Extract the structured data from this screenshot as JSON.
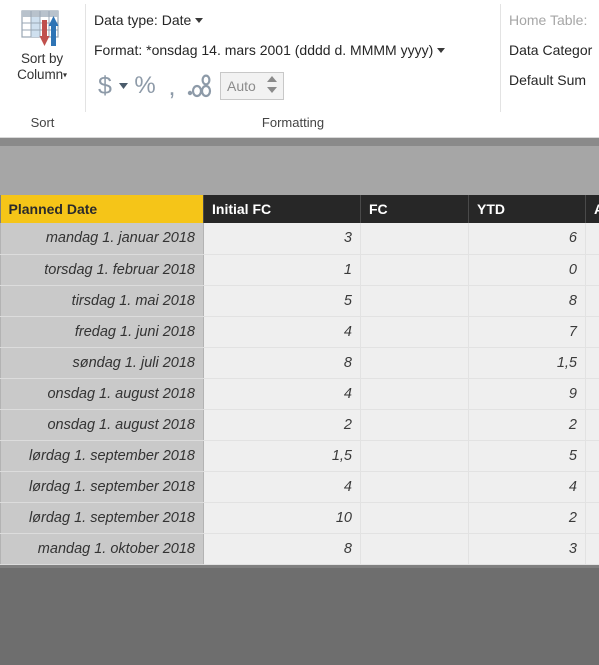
{
  "ribbon": {
    "sort_group": {
      "button_label_line1": "Sort by",
      "button_label_line2": "Column",
      "dropdown_caret": "▾",
      "icon": "sort-by-column-icon",
      "group_title": "Sort"
    },
    "formatting_group": {
      "data_type_label": "Data type: Date",
      "format_label": "Format: *onsdag 14. mars 2001 (dddd d. MMMM yyyy)",
      "currency_symbol": "$",
      "percent_symbol": "%",
      "comma_symbol": ",",
      "decimal_symbol": ".00",
      "decimal_places_value": "Auto",
      "group_title": "Formatting"
    },
    "properties_group": {
      "home_table_label": "Home Table:",
      "data_category_label": "Data Categor",
      "default_summarization_label": "Default Sum"
    }
  },
  "grid": {
    "sorted_column_index": 0,
    "columns": [
      {
        "header": "Planned Date",
        "align": "right",
        "sorted": true
      },
      {
        "header": "Initial FC",
        "align": "right",
        "sorted": false
      },
      {
        "header": "FC",
        "align": "right",
        "sorted": false
      },
      {
        "header": "YTD",
        "align": "right",
        "sorted": false
      },
      {
        "header": "A",
        "align": "right",
        "sorted": false
      }
    ],
    "rows": [
      {
        "planned_date": "mandag 1. januar 2018",
        "initial_fc": "3",
        "fc": "",
        "ytd": "6",
        "a": ""
      },
      {
        "planned_date": "torsdag 1. februar 2018",
        "initial_fc": "1",
        "fc": "",
        "ytd": "0",
        "a": ""
      },
      {
        "planned_date": "tirsdag 1. mai 2018",
        "initial_fc": "5",
        "fc": "",
        "ytd": "8",
        "a": ""
      },
      {
        "planned_date": "fredag 1. juni 2018",
        "initial_fc": "4",
        "fc": "",
        "ytd": "7",
        "a": ""
      },
      {
        "planned_date": "søndag 1. juli 2018",
        "initial_fc": "8",
        "fc": "",
        "ytd": "1,5",
        "a": ""
      },
      {
        "planned_date": "onsdag 1. august 2018",
        "initial_fc": "4",
        "fc": "",
        "ytd": "9",
        "a": ""
      },
      {
        "planned_date": "onsdag 1. august 2018",
        "initial_fc": "2",
        "fc": "",
        "ytd": "2",
        "a": ""
      },
      {
        "planned_date": "lørdag 1. september 2018",
        "initial_fc": "1,5",
        "fc": "",
        "ytd": "5",
        "a": ""
      },
      {
        "planned_date": "lørdag 1. september 2018",
        "initial_fc": "4",
        "fc": "",
        "ytd": "4",
        "a": ""
      },
      {
        "planned_date": "lørdag 1. september 2018",
        "initial_fc": "10",
        "fc": "",
        "ytd": "2",
        "a": ""
      },
      {
        "planned_date": "mandag 1. oktober 2018",
        "initial_fc": "8",
        "fc": "",
        "ytd": "3",
        "a": ""
      }
    ]
  },
  "colors": {
    "sorted_header_bg": "#f5c518",
    "header_bg": "#272727",
    "date_column_bg": "#c9c9c9",
    "cell_bg": "#efefef",
    "band_bg": "#a6a6a6",
    "canvas_bg": "#6e6e6e"
  }
}
